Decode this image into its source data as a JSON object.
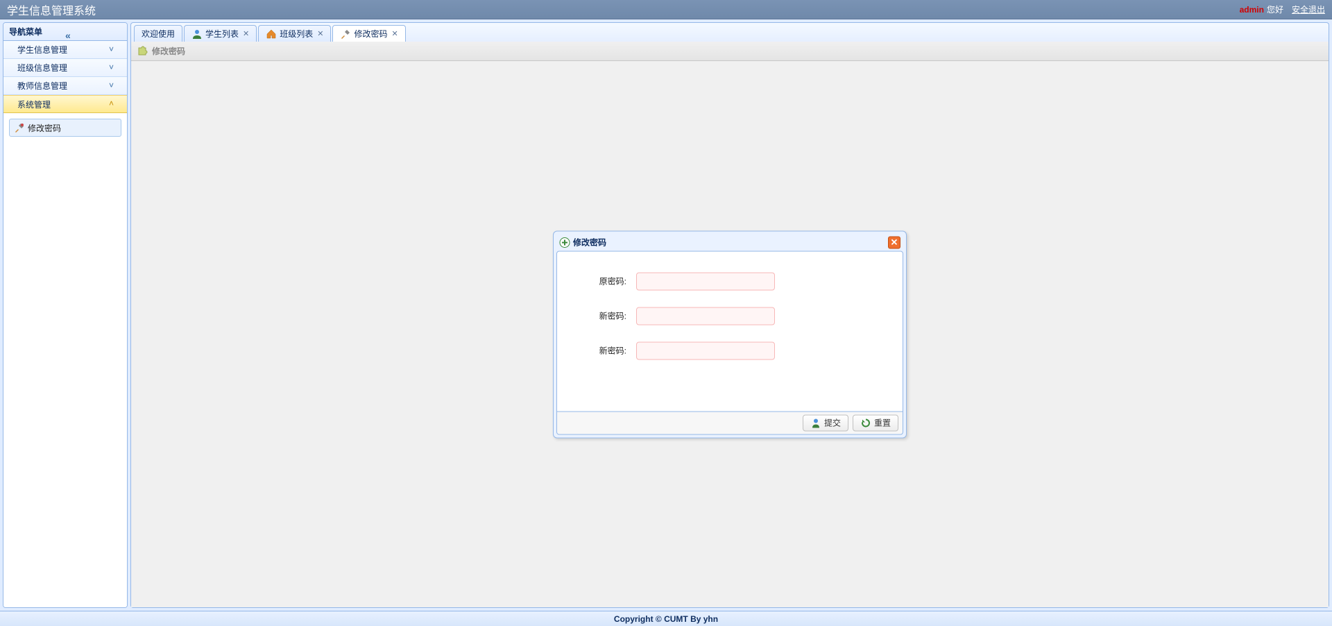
{
  "header": {
    "title": "学生信息管理系统",
    "user": "admin",
    "greeting": "您好",
    "logout": "安全退出"
  },
  "sidebar": {
    "title": "导航菜单",
    "items": [
      {
        "label": "学生信息管理",
        "selected": false
      },
      {
        "label": "班级信息管理",
        "selected": false
      },
      {
        "label": "教师信息管理",
        "selected": false
      },
      {
        "label": "系统管理",
        "selected": true
      }
    ],
    "tree_node": "修改密码"
  },
  "tabs": [
    {
      "label": "欢迎使用",
      "closable": false,
      "icon": null,
      "active": false
    },
    {
      "label": "学生列表",
      "closable": true,
      "icon": "user",
      "active": false
    },
    {
      "label": "班级列表",
      "closable": true,
      "icon": "home",
      "active": false
    },
    {
      "label": "修改密码",
      "closable": true,
      "icon": "tools",
      "active": true
    }
  ],
  "panel": {
    "title": "修改密码"
  },
  "dialog": {
    "title": "修改密码",
    "fields": [
      {
        "label": "原密码:",
        "value": ""
      },
      {
        "label": "新密码:",
        "value": ""
      },
      {
        "label": "新密码:",
        "value": ""
      }
    ],
    "submit": "提交",
    "reset": "重置"
  },
  "footer": "Copyright © CUMT By yhn"
}
